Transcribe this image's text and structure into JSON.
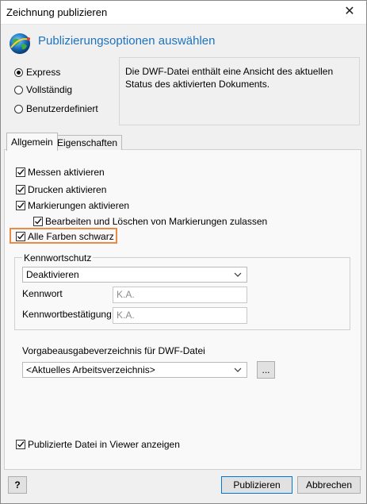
{
  "window": {
    "title": "Zeichnung publizieren",
    "close_glyph": "✕"
  },
  "header": {
    "icon": "globe-icon",
    "text": "Publizierungsoptionen auswählen"
  },
  "publish_mode": {
    "options": [
      "Express",
      "Vollständig",
      "Benutzerdefiniert"
    ],
    "selected": "Express"
  },
  "description": "Die DWF-Datei enthält eine Ansicht des aktuellen Status des aktivierten Dokuments.",
  "tabs": [
    {
      "label": "Allgemein",
      "active": true
    },
    {
      "label": "Eigenschaften",
      "active": false
    }
  ],
  "general": {
    "checkboxes": [
      {
        "label": "Messen aktivieren",
        "checked": true
      },
      {
        "label": "Drucken aktivieren",
        "checked": true
      },
      {
        "label": "Markierungen aktivieren",
        "checked": true
      },
      {
        "label": "Bearbeiten und Löschen von Markierungen zulassen",
        "checked": true
      },
      {
        "label": "Alle Farben schwarz",
        "checked": true
      }
    ],
    "password": {
      "group_label": "Kennwortschutz",
      "mode": "Deaktivieren",
      "password_label": "Kennwort",
      "password_value": "K.A.",
      "confirm_label": "Kennwortbestätigung",
      "confirm_value": "K.A."
    },
    "output_dir": {
      "label": "Vorgabeausgabeverzeichnis für DWF-Datei",
      "value": "<Aktuelles Arbeitsverzeichnis>",
      "browse_label": "..."
    },
    "show_in_viewer": {
      "label": "Publizierte Datei in Viewer anzeigen",
      "checked": true
    }
  },
  "footer": {
    "help_icon": "help-icon",
    "help_glyph": "?",
    "publish_label": "Publizieren",
    "cancel_label": "Abbrechen"
  },
  "colors": {
    "heading": "#1e73be",
    "highlight": "#ec8a47",
    "primary_border": "#0078d7"
  }
}
